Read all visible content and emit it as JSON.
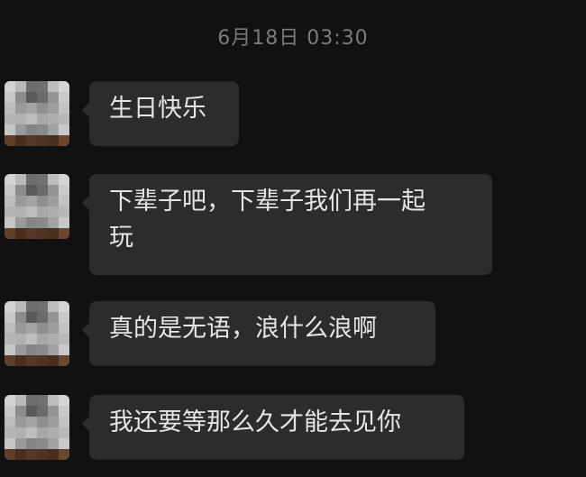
{
  "chat": {
    "timestamp": "6月18日 03:30",
    "messages": [
      {
        "sender": "contact",
        "text": "生日快乐"
      },
      {
        "sender": "contact",
        "text": "下辈子吧，下辈子我们再一起\n玩"
      },
      {
        "sender": "contact",
        "text": "真的是无语，浪什么浪啊"
      },
      {
        "sender": "contact",
        "text": "我还要等那么久才能去见你"
      }
    ]
  },
  "theme": {
    "background": "#111111",
    "bubble": "#2c2c2c",
    "text": "#e6e6e6",
    "timestamp": "#7b7b7b"
  }
}
